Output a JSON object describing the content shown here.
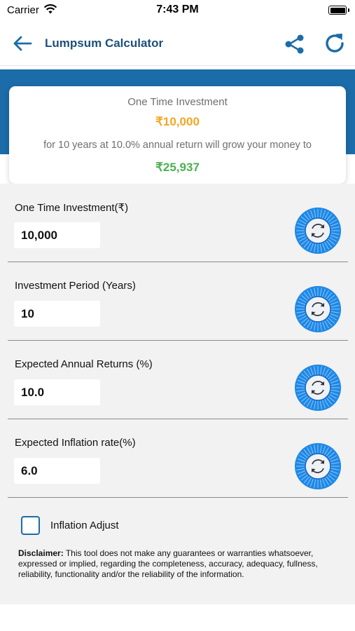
{
  "status_bar": {
    "carrier": "Carrier",
    "time": "7:43 PM"
  },
  "app_bar": {
    "title": "Lumpsum Calculator",
    "back_icon": "arrow-left-icon",
    "share_icon": "share-icon",
    "refresh_icon": "refresh-icon"
  },
  "summary": {
    "label": "One Time Investment",
    "amount": "₹10,000",
    "description": "for 10 years at 10.0% annual return will grow your money to",
    "result": "₹25,937"
  },
  "fields": [
    {
      "label": "One Time Investment(₹)",
      "value": "10,000"
    },
    {
      "label": "Investment Period (Years)",
      "value": "10"
    },
    {
      "label": "Expected Annual Returns (%)",
      "value": "10.0"
    },
    {
      "label": "Expected Inflation rate(%)",
      "value": "6.0"
    }
  ],
  "inflation_adjust": {
    "label": "Inflation Adjust",
    "checked": false
  },
  "disclaimer": {
    "title": "Disclaimer:",
    "text": " This tool does not make any guarantees or warranties whatsoever, expressed or implied, regarding the completeness, accuracy, adequacy, fullness, reliability, functionality and/or the reliability of the information."
  },
  "colors": {
    "brand": "#1d4f7c",
    "banner": "#1b6ca8",
    "amount": "#f5a623",
    "result": "#4caf50",
    "dial": "#1e88e5"
  }
}
